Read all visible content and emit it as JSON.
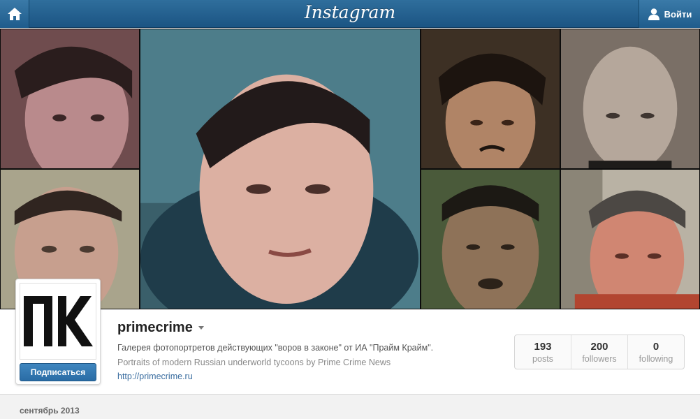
{
  "topbar": {
    "brand": "Instagram",
    "login_label": "Войти"
  },
  "grid": {
    "photos": [
      {
        "name": "portrait-1",
        "tone": "#b98a8c"
      },
      {
        "name": "portrait-2",
        "tone": "#c79f8e"
      },
      {
        "name": "portrait-3",
        "tone": "#8d6f52"
      },
      {
        "name": "portrait-4",
        "tone": "#a89b8f"
      },
      {
        "name": "portrait-5",
        "tone": "#b28b68"
      },
      {
        "name": "portrait-6",
        "tone": "#7b6348"
      },
      {
        "name": "portrait-7",
        "tone": "#c77965"
      }
    ]
  },
  "profile": {
    "avatar_text": "ПК",
    "subscribe_label": "Подписаться",
    "username": "primecrime",
    "bio_ru": "Галерея фотопортретов действующих \"воров в законе\" от ИА \"Прайм Крайм\".",
    "bio_en": "Portraits of modern Russian underworld tycoons by Prime Crime News",
    "website": "http://primecrime.ru",
    "stats": [
      {
        "value": "193",
        "label": "posts"
      },
      {
        "value": "200",
        "label": "followers"
      },
      {
        "value": "0",
        "label": "following"
      }
    ]
  },
  "feed": {
    "month_label": "сентябрь 2013"
  },
  "colors": {
    "topbar": "#1f5c8c",
    "button": "#2a6ca5",
    "link": "#3b6ea0"
  }
}
